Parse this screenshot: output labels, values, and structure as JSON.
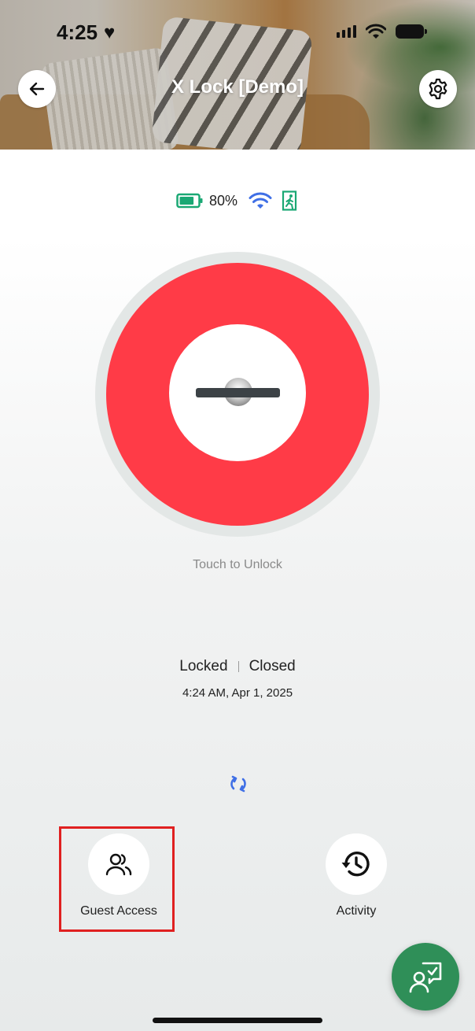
{
  "status_bar": {
    "time": "4:25",
    "heart": "♥"
  },
  "header": {
    "title": "X Lock [Demo]",
    "back_icon": "arrow-left-icon",
    "settings_icon": "gear-icon"
  },
  "device": {
    "battery_percent": "80%",
    "battery_level": 0.8,
    "battery_color": "#1aa874",
    "wifi_color": "#3f6fe6",
    "door_sensor_color": "#1aa874"
  },
  "lock": {
    "state_color": "#ff3b47",
    "hint": "Touch to Unlock",
    "status": "Locked",
    "door": "Closed",
    "timestamp": "4:24 AM, Apr 1, 2025"
  },
  "actions": [
    {
      "label": "Guest Access",
      "icon": "users-icon"
    },
    {
      "label": "Activity",
      "icon": "history-icon"
    }
  ],
  "fab": {
    "icon": "support-chat-icon",
    "color": "#2f8f58"
  }
}
